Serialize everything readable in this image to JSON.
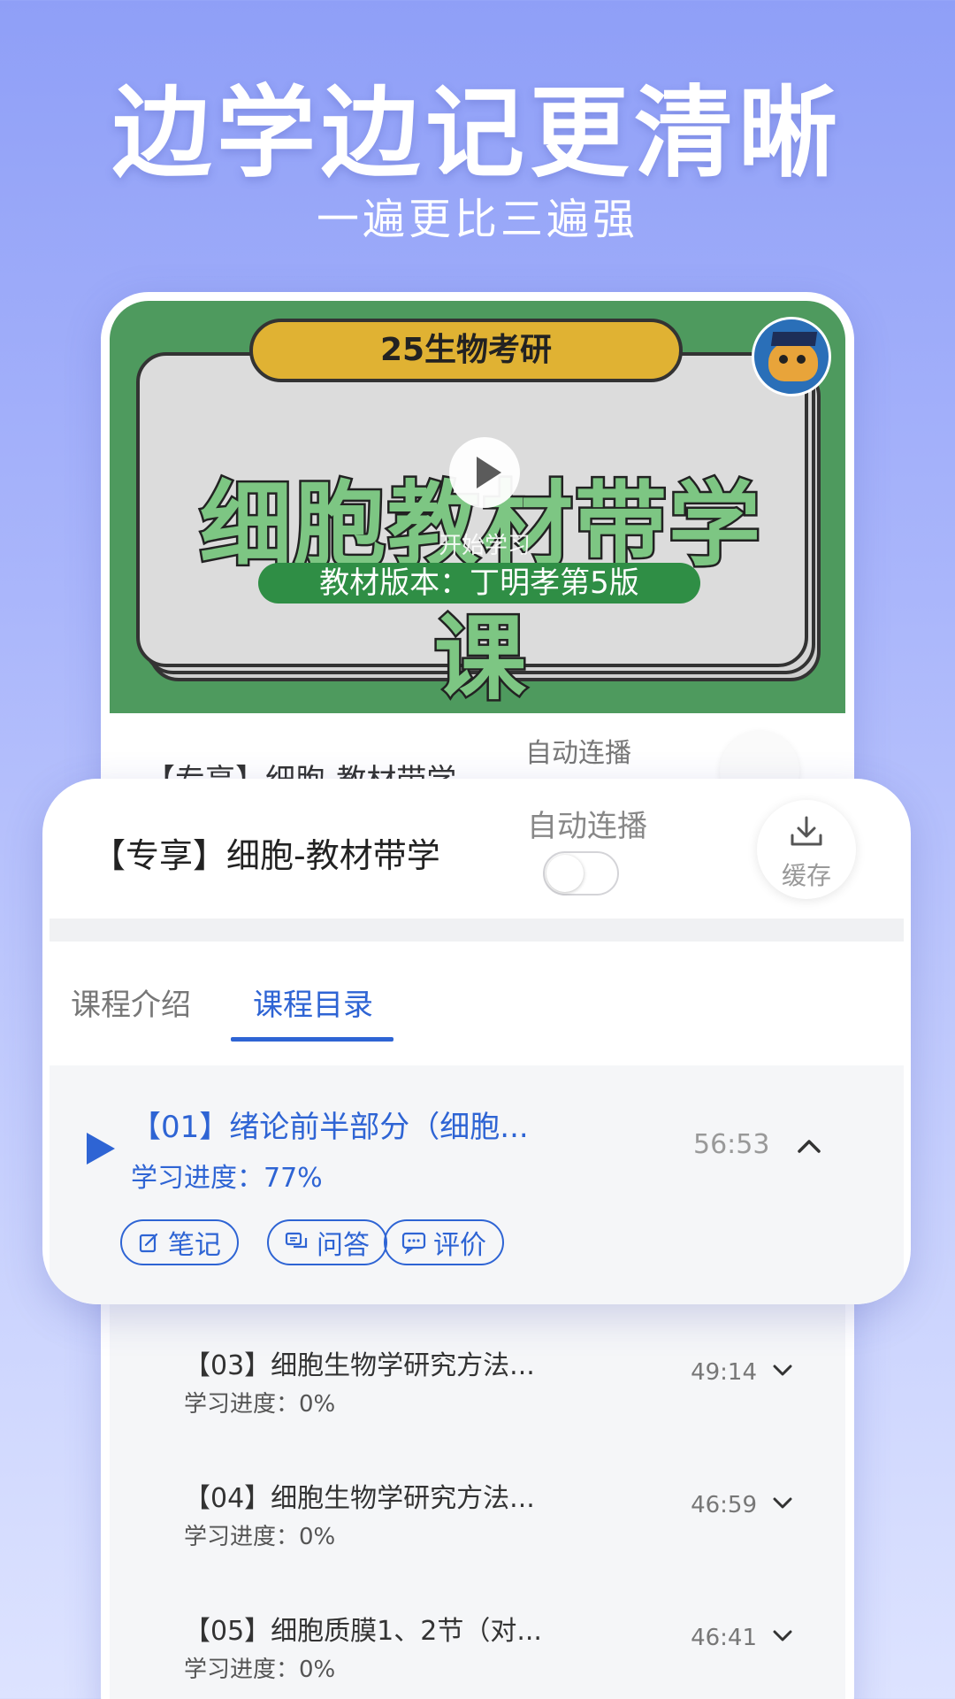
{
  "hero": {
    "title": "边学边记更清晰",
    "subtitle": "一遍更比三遍强"
  },
  "video": {
    "banner_top": "25生物考研",
    "banner_title": "细胞教材带学课",
    "edition": "教材版本：丁明孝第5版",
    "start_label": "开始学习"
  },
  "under": {
    "title": "【专享】细胞-教材带学",
    "auto_play": "自动连播",
    "cache": "缓存"
  },
  "card": {
    "title": "【专享】细胞-教材带学",
    "auto_play_label": "自动连播",
    "auto_play_on": false,
    "cache_label": "缓存",
    "tabs": [
      "课程介绍",
      "课程目录"
    ],
    "active_tab": "课程目录",
    "active_lesson": {
      "title": "【01】绪论前半部分（细胞...",
      "progress": "学习进度：77%",
      "duration": "56:53",
      "actions": [
        "笔记",
        "问答",
        "评价"
      ]
    }
  },
  "lessons": [
    {
      "title": "【03】细胞生物学研究方法...",
      "progress": "学习进度：0%",
      "duration": "49:14"
    },
    {
      "title": "【04】细胞生物学研究方法...",
      "progress": "学习进度：0%",
      "duration": "46:59"
    },
    {
      "title": "【05】细胞质膜1、2节（对...",
      "progress": "学习进度：0%",
      "duration": "46:41"
    }
  ],
  "colors": {
    "accent": "#2e64d4",
    "video_bg": "#4e9a5e",
    "banner_pill": "#e0b233",
    "edition_bg": "#2f8e45"
  }
}
